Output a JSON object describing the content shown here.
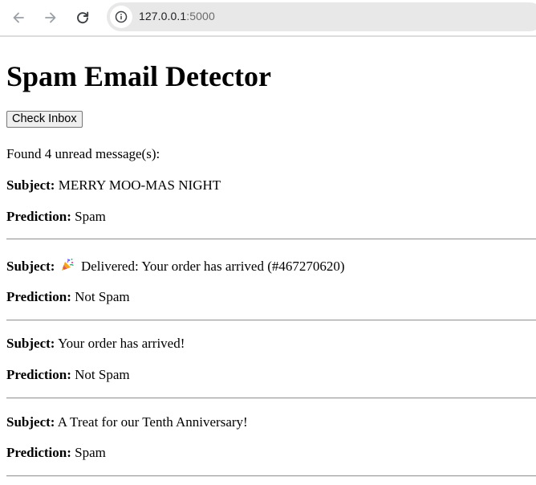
{
  "browser": {
    "url_host": "127.0.0.1",
    "url_port": ":5000"
  },
  "page": {
    "title": "Spam Email Detector",
    "check_button": "Check Inbox",
    "found_text": "Found 4 unread message(s):",
    "subject_label": "Subject:",
    "prediction_label": "Prediction:"
  },
  "messages": [
    {
      "subject": "MERRY MOO-MAS NIGHT",
      "prediction": "Spam"
    },
    {
      "subject": "Delivered: Your order has arrived (#467270620)",
      "prediction": "Not Spam",
      "icon": "party-popper-icon"
    },
    {
      "subject": "Your order has arrived!",
      "prediction": "Not Spam"
    },
    {
      "subject": "A Treat for our Tenth Anniversary!",
      "prediction": "Spam"
    }
  ]
}
